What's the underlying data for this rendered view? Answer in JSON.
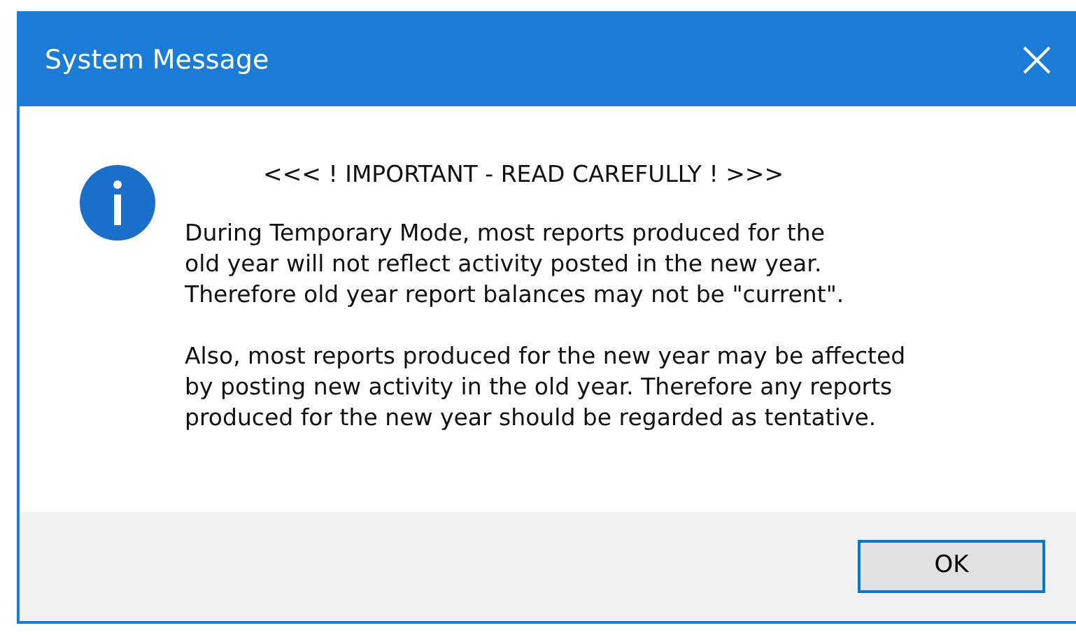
{
  "window": {
    "title": "System Message"
  },
  "message": {
    "heading": "<<< ! IMPORTANT - READ CAREFULLY ! >>>",
    "paragraphs": [
      [
        "During Temporary Mode, most reports produced for the",
        "old year will not reflect activity posted in the new year.",
        "Therefore old year report balances may not be \"current\"."
      ],
      [
        "Also, most reports produced for the new year may be affected",
        "by posting new activity in the old year. Therefore any reports",
        "produced for the new year should be regarded as tentative."
      ]
    ]
  },
  "buttons": [
    {
      "label": "OK",
      "default": true
    }
  ]
}
